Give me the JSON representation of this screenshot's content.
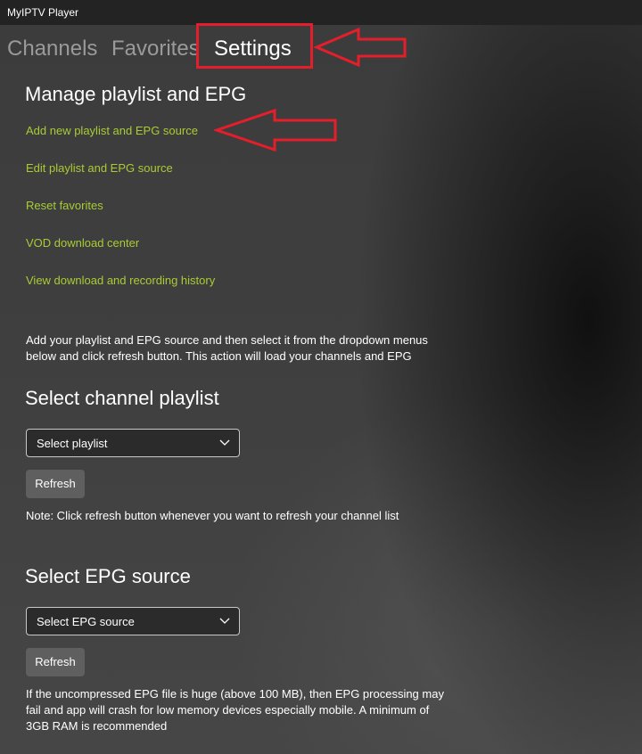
{
  "app": {
    "title": "MyIPTV Player"
  },
  "tabs": [
    {
      "label": "Channels",
      "active": false
    },
    {
      "label": "Favorites",
      "active": false
    },
    {
      "label": "Settings",
      "active": true
    }
  ],
  "manage": {
    "heading": "Manage playlist and EPG",
    "links": [
      "Add new playlist and EPG source",
      "Edit playlist and EPG source",
      "Reset favorites",
      "VOD download center",
      "View download and recording history"
    ]
  },
  "instructions": {
    "line1": "Add your playlist and EPG source and then select it from the dropdown menus",
    "line2": "below and click refresh button. This action will load your channels and EPG"
  },
  "playlist": {
    "heading": "Select channel playlist",
    "dropdown_value": "Select playlist",
    "refresh_label": "Refresh",
    "note": "Note: Click refresh button whenever you want to refresh your channel list"
  },
  "epg": {
    "heading": "Select EPG source",
    "dropdown_value": "Select EPG source",
    "refresh_label": "Refresh",
    "warning_line1": "If the uncompressed EPG file is huge (above 100 MB), then EPG processing may",
    "warning_line2": "fail and app will crash for low memory devices especially mobile. A minimum of",
    "warning_line3": "3GB RAM is recommended"
  },
  "colors": {
    "accent_link": "#a8cc34",
    "annotation_red": "#e41e2b",
    "titlebar": "#232323"
  },
  "icons": {
    "dropdown_chevron": "chevron-down-icon",
    "annotation_arrow": "left-arrow-annotation-icon"
  }
}
